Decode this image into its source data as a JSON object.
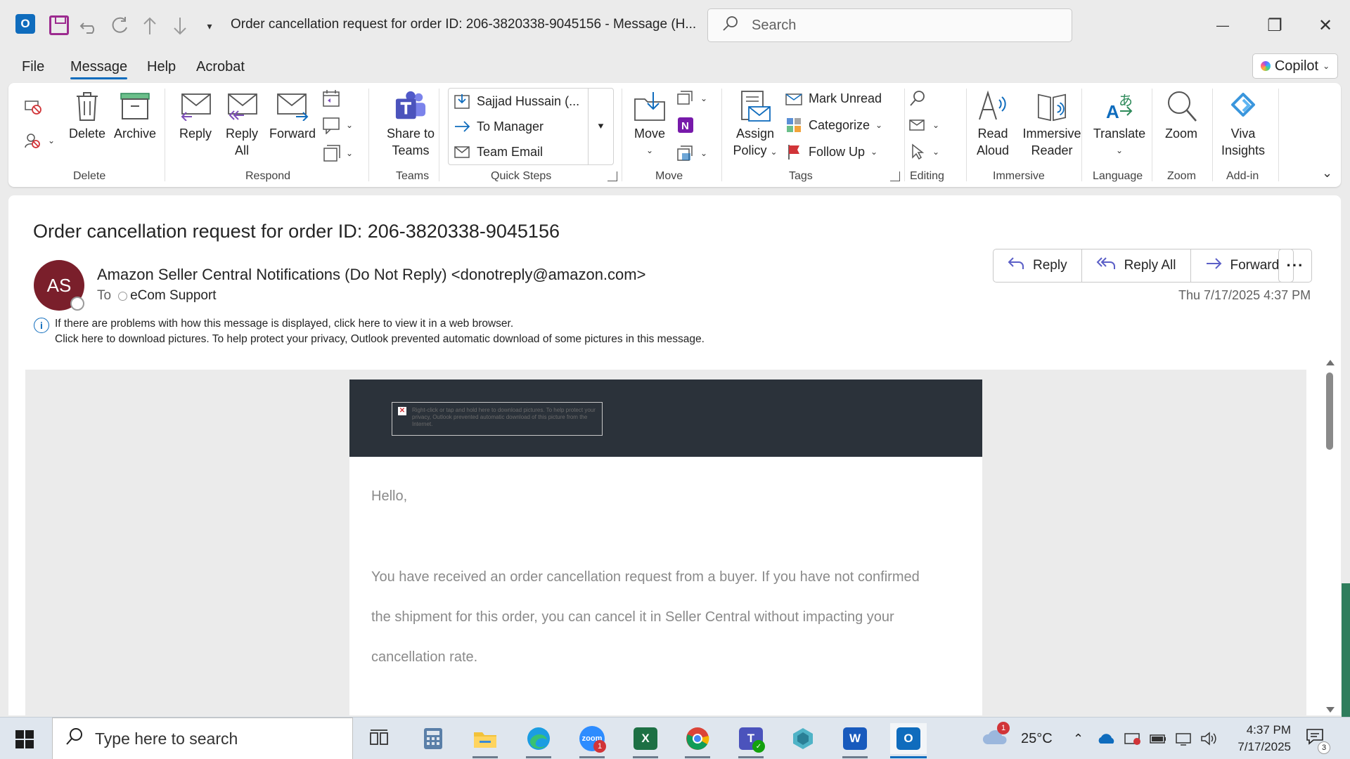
{
  "window": {
    "title": "Order cancellation request for order ID: 206-3820338-9045156  -  Message (H...",
    "search_placeholder": "Search",
    "minimize_glyph": "—",
    "restore_glyph": "❐",
    "close_glyph": "✕"
  },
  "menu": {
    "tabs": [
      "File",
      "Message",
      "Help",
      "Acrobat"
    ],
    "active_tab": "Message",
    "copilot_label": "Copilot"
  },
  "ribbon": {
    "delete_group": {
      "label": "Delete",
      "delete": "Delete",
      "archive": "Archive"
    },
    "respond_group": {
      "label": "Respond",
      "reply": "Reply",
      "reply_all_1": "Reply",
      "reply_all_2": "All",
      "forward": "Forward"
    },
    "teams_group": {
      "label": "Teams",
      "share_1": "Share to",
      "share_2": "Teams"
    },
    "quick_steps": {
      "label": "Quick Steps",
      "items": [
        "Sajjad Hussain (...",
        "To Manager",
        "Team Email"
      ]
    },
    "move_group": {
      "label": "Move",
      "move": "Move"
    },
    "tags_group": {
      "label": "Tags",
      "assign_1": "Assign",
      "assign_2": "Policy",
      "mark_unread": "Mark Unread",
      "categorize": "Categorize",
      "follow_up": "Follow Up"
    },
    "editing_group": {
      "label": "Editing"
    },
    "immersive_group": {
      "label": "Immersive",
      "read_1": "Read",
      "read_2": "Aloud",
      "reader_1": "Immersive",
      "reader_2": "Reader"
    },
    "language_group": {
      "label": "Language",
      "translate": "Translate"
    },
    "zoom_group": {
      "label": "Zoom",
      "zoom": "Zoom"
    },
    "addin_group": {
      "label": "Add-in",
      "viva_1": "Viva",
      "viva_2": "Insights"
    }
  },
  "message": {
    "subject": "Order cancellation request for order ID: 206-3820338-9045156",
    "avatar_initials": "AS",
    "sender": "Amazon Seller Central Notifications (Do Not Reply) <donotreply@amazon.com>",
    "to_label": "To",
    "recipient": "eCom Support",
    "date": "Thu 7/17/2025 4:37 PM",
    "actions": {
      "reply": "Reply",
      "reply_all": "Reply All",
      "forward": "Forward"
    },
    "info_line_1": "If there are problems with how this message is displayed, click here to view it in a web browser.",
    "info_line_2": "Click here to download pictures. To help protect your privacy, Outlook prevented automatic download of some pictures in this message.",
    "blocked_image_text": "Right-click or tap and hold here to download pictures. To help protect your privacy, Outlook prevented automatic download of this picture from the Internet.",
    "body": {
      "greeting": "Hello,",
      "line1": "You have received an order cancellation request from a buyer. If you have not confirmed",
      "line2": "the shipment for this order, you can cancel it in Seller Central without impacting your",
      "line3": "cancellation rate."
    }
  },
  "taskbar": {
    "search_placeholder": "Type here to search",
    "zoom_badge": "1",
    "weather_badge": "1",
    "temperature": "25°C",
    "time": "4:37 PM",
    "date": "7/17/2025",
    "notification_count": "3"
  },
  "colors": {
    "accent": "#0f6cbd",
    "avatar_bg": "#7a1f2b",
    "email_header_bg": "#2b323a"
  }
}
